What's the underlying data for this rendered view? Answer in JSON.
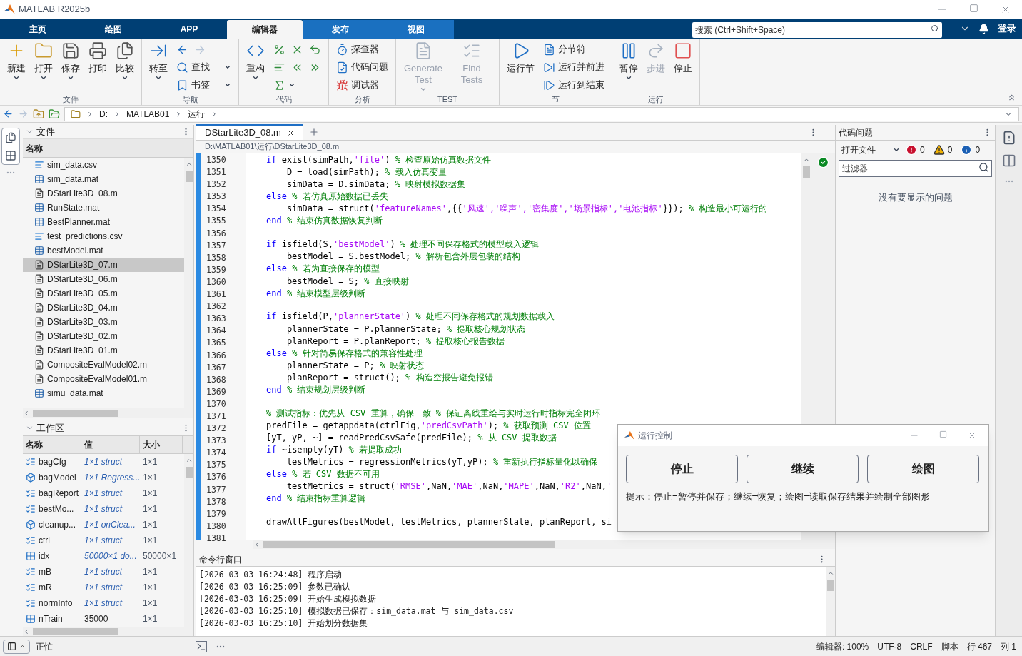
{
  "window": {
    "title": "MATLAB R2025b"
  },
  "tabs": [
    {
      "label": "主页",
      "selected": false,
      "kind": "standard"
    },
    {
      "label": "绘图",
      "selected": false,
      "kind": "standard"
    },
    {
      "label": "APP",
      "selected": false,
      "kind": "standard"
    },
    {
      "label": "编辑器",
      "selected": true,
      "kind": "contextual"
    },
    {
      "label": "发布",
      "selected": false,
      "kind": "contextual"
    },
    {
      "label": "视图",
      "selected": false,
      "kind": "contextual"
    }
  ],
  "search": {
    "placeholder": "搜索 (Ctrl+Shift+Space)"
  },
  "login": "登录",
  "toolstrip": [
    {
      "label": "文件",
      "items": [
        {
          "kind": "large",
          "label": "新建",
          "dropdown": true,
          "disabled": false
        },
        {
          "kind": "large",
          "label": "打开",
          "dropdown": true,
          "disabled": false
        },
        {
          "kind": "large",
          "label": "保存",
          "dropdown": true,
          "disabled": false
        },
        {
          "kind": "large",
          "label": "打印",
          "dropdown": false,
          "disabled": false
        },
        {
          "kind": "large",
          "label": "比较",
          "dropdown": true,
          "disabled": false
        }
      ]
    },
    {
      "label": "导航",
      "items": [
        {
          "kind": "large",
          "label": "转至",
          "dropdown": true,
          "disabled": false
        },
        {
          "kind": "stack",
          "rows": [
            [
              {
                "dropdown": false,
                "disabled": false
              },
              {
                "dropdown": false,
                "disabled": true
              }
            ],
            [
              {
                "label": "查找",
                "dropdown": true,
                "disabled": false
              }
            ],
            [
              {
                "label": "书签",
                "dropdown": true,
                "disabled": false
              }
            ]
          ]
        }
      ]
    },
    {
      "label": "代码",
      "items": [
        {
          "kind": "large",
          "label": "重构",
          "dropdown": true,
          "disabled": false
        },
        {
          "kind": "stack",
          "rows": [
            [
              {
                "dropdown": false,
                "disabled": false
              },
              {
                "dropdown": false,
                "disabled": false
              },
              {
                "dropdown": false,
                "disabled": false
              }
            ],
            [
              {
                "dropdown": false,
                "disabled": false
              },
              {
                "dropdown": false,
                "disabled": false
              },
              {
                "dropdown": false,
                "disabled": false
              }
            ],
            [
              {
                "dropdown": true,
                "disabled": false
              }
            ]
          ]
        }
      ]
    },
    {
      "label": "分析",
      "items": [
        {
          "kind": "stack",
          "rows": [
            [
              {
                "label": "探查器",
                "dropdown": false,
                "disabled": false
              }
            ],
            [
              {
                "label": "代码问题",
                "dropdown": false,
                "disabled": false
              }
            ],
            [
              {
                "label": "调试器",
                "dropdown": false,
                "disabled": false
              }
            ]
          ]
        }
      ]
    },
    {
      "label": "TEST",
      "items": [
        {
          "kind": "large",
          "label": "Generate Test",
          "dropdown": true,
          "disabled": true
        },
        {
          "kind": "large",
          "label": "Find Tests",
          "dropdown": false,
          "disabled": true
        }
      ]
    },
    {
      "label": "节",
      "items": [
        {
          "kind": "large",
          "label": "运行节",
          "dropdown": false,
          "disabled": false
        },
        {
          "kind": "stack",
          "rows": [
            [
              {
                "label": "分节符",
                "dropdown": false,
                "disabled": false
              }
            ],
            [
              {
                "label": "运行并前进",
                "dropdown": false,
                "disabled": false
              }
            ],
            [
              {
                "label": "运行到结束",
                "dropdown": false,
                "disabled": false
              }
            ]
          ]
        }
      ]
    },
    {
      "label": "运行",
      "items": [
        {
          "kind": "large",
          "label": "暂停",
          "dropdown": true,
          "disabled": false
        },
        {
          "kind": "large",
          "label": "步进",
          "dropdown": false,
          "disabled": true
        },
        {
          "kind": "large",
          "label": "停止",
          "dropdown": false,
          "disabled": false
        }
      ]
    }
  ],
  "address": {
    "back_disabled": false,
    "forward_disabled": true,
    "path": [
      "D:",
      "MATLAB01",
      "运行"
    ]
  },
  "files": {
    "title": "文件",
    "column": "名称",
    "items": [
      {
        "name": "sim_data.csv",
        "kind": "csv",
        "selected": false
      },
      {
        "name": "sim_data.mat",
        "kind": "mat",
        "selected": false
      },
      {
        "name": "DStarLite3D_08.m",
        "kind": "m",
        "selected": false
      },
      {
        "name": "RunState.mat",
        "kind": "mat",
        "selected": false
      },
      {
        "name": "BestPlanner.mat",
        "kind": "mat",
        "selected": false
      },
      {
        "name": "test_predictions.csv",
        "kind": "csv",
        "selected": false
      },
      {
        "name": "bestModel.mat",
        "kind": "mat",
        "selected": false
      },
      {
        "name": "DStarLite3D_07.m",
        "kind": "m",
        "selected": true
      },
      {
        "name": "DStarLite3D_06.m",
        "kind": "m",
        "selected": false
      },
      {
        "name": "DStarLite3D_05.m",
        "kind": "m",
        "selected": false
      },
      {
        "name": "DStarLite3D_04.m",
        "kind": "m",
        "selected": false
      },
      {
        "name": "DStarLite3D_03.m",
        "kind": "m",
        "selected": false
      },
      {
        "name": "DStarLite3D_02.m",
        "kind": "m",
        "selected": false
      },
      {
        "name": "DStarLite3D_01.m",
        "kind": "m",
        "selected": false
      },
      {
        "name": "CompositeEvalModel02.m",
        "kind": "m",
        "selected": false
      },
      {
        "name": "CompositeEvalModel01.m",
        "kind": "m",
        "selected": false
      },
      {
        "name": "simu_data.mat",
        "kind": "mat",
        "selected": false
      }
    ]
  },
  "workspace": {
    "title": "工作区",
    "columns": [
      "名称",
      "值",
      "大小"
    ],
    "rows": [
      {
        "name": "bagCfg",
        "value": "1×1 struct",
        "size": "1×1",
        "kind": "struct",
        "summary": true
      },
      {
        "name": "bagModel",
        "value": "1×1 Regress...",
        "size": "1×1",
        "kind": "object",
        "summary": true
      },
      {
        "name": "bagReport",
        "value": "1×1 struct",
        "size": "1×1",
        "kind": "struct",
        "summary": true
      },
      {
        "name": "bestMo...",
        "value": "1×1 struct",
        "size": "1×1",
        "kind": "struct",
        "summary": true
      },
      {
        "name": "cleanup...",
        "value": "1×1 onClea...",
        "size": "1×1",
        "kind": "object",
        "summary": true
      },
      {
        "name": "ctrl",
        "value": "1×1 struct",
        "size": "1×1",
        "kind": "struct",
        "summary": true
      },
      {
        "name": "idx",
        "value": "50000×1 do...",
        "size": "50000×1",
        "kind": "matrix",
        "summary": true
      },
      {
        "name": "mB",
        "value": "1×1 struct",
        "size": "1×1",
        "kind": "struct",
        "summary": true
      },
      {
        "name": "mR",
        "value": "1×1 struct",
        "size": "1×1",
        "kind": "struct",
        "summary": true
      },
      {
        "name": "normInfo",
        "value": "1×1 struct",
        "size": "1×1",
        "kind": "struct",
        "summary": true
      },
      {
        "name": "nTrain",
        "value": "35000",
        "size": "1×1",
        "kind": "matrix",
        "summary": false
      }
    ]
  },
  "editor": {
    "tabs": [
      {
        "label": "DStarLite3D_08.m",
        "selected": true
      }
    ],
    "path": "D:\\MATLAB01\\运行\\DStarLite3D_08.m",
    "lines": [
      {
        "number": "1350",
        "segments": [
          {
            "kind": "keyword",
            "text": "if"
          },
          {
            "kind": "plain",
            "text": " exist(simPath,"
          },
          {
            "kind": "string",
            "text": "'file'"
          },
          {
            "kind": "plain",
            "text": ") "
          },
          {
            "kind": "comment",
            "text": "% 检查原始仿真数据文件"
          }
        ]
      },
      {
        "number": "1351",
        "segments": [
          {
            "kind": "plain",
            "text": "    D = load(simPath); "
          },
          {
            "kind": "comment",
            "text": "% 载入仿真变量"
          }
        ]
      },
      {
        "number": "1352",
        "segments": [
          {
            "kind": "plain",
            "text": "    simData = D.simData; "
          },
          {
            "kind": "comment",
            "text": "% 映射模拟数据集"
          }
        ]
      },
      {
        "number": "1353",
        "segments": [
          {
            "kind": "keyword",
            "text": "else"
          },
          {
            "kind": "comment",
            "text": " % 若仿真原始数据已丢失"
          }
        ]
      },
      {
        "number": "1354",
        "segments": [
          {
            "kind": "plain",
            "text": "    simData = struct("
          },
          {
            "kind": "string",
            "text": "'featureNames'"
          },
          {
            "kind": "plain",
            "text": ",{{"
          },
          {
            "kind": "string",
            "text": "'风速','噪声','密集度','场景指标','电池指标'"
          },
          {
            "kind": "plain",
            "text": "}}); "
          },
          {
            "kind": "comment",
            "text": "% 构造最小可运行的"
          }
        ]
      },
      {
        "number": "1355",
        "segments": [
          {
            "kind": "keyword",
            "text": "end"
          },
          {
            "kind": "comment",
            "text": " % 结束仿真数据恢复判断"
          }
        ]
      },
      {
        "number": "1356"
      },
      {
        "number": "1357",
        "segments": [
          {
            "kind": "keyword",
            "text": "if"
          },
          {
            "kind": "plain",
            "text": " isfield(S,"
          },
          {
            "kind": "string",
            "text": "'bestModel'"
          },
          {
            "kind": "plain",
            "text": ") "
          },
          {
            "kind": "comment",
            "text": "% 处理不同保存格式的模型载入逻辑"
          }
        ]
      },
      {
        "number": "1358",
        "segments": [
          {
            "kind": "plain",
            "text": "    bestModel = S.bestModel; "
          },
          {
            "kind": "comment",
            "text": "% 解析包含外层包装的结构"
          }
        ]
      },
      {
        "number": "1359",
        "segments": [
          {
            "kind": "keyword",
            "text": "else"
          },
          {
            "kind": "comment",
            "text": " % 若为直接保存的模型"
          }
        ]
      },
      {
        "number": "1360",
        "segments": [
          {
            "kind": "plain",
            "text": "    bestModel = S; "
          },
          {
            "kind": "comment",
            "text": "% 直接映射"
          }
        ]
      },
      {
        "number": "1361",
        "segments": [
          {
            "kind": "keyword",
            "text": "end"
          },
          {
            "kind": "comment",
            "text": " % 结束模型层级判断"
          }
        ]
      },
      {
        "number": "1362"
      },
      {
        "number": "1363",
        "segments": [
          {
            "kind": "keyword",
            "text": "if"
          },
          {
            "kind": "plain",
            "text": " isfield(P,"
          },
          {
            "kind": "string",
            "text": "'plannerState'"
          },
          {
            "kind": "plain",
            "text": ") "
          },
          {
            "kind": "comment",
            "text": "% 处理不同保存格式的规划数据载入"
          }
        ]
      },
      {
        "number": "1364",
        "segments": [
          {
            "kind": "plain",
            "text": "    plannerState = P.plannerState; "
          },
          {
            "kind": "comment",
            "text": "% 提取核心规划状态"
          }
        ]
      },
      {
        "number": "1365",
        "segments": [
          {
            "kind": "plain",
            "text": "    planReport = P.planReport; "
          },
          {
            "kind": "comment",
            "text": "% 提取核心报告数据"
          }
        ]
      },
      {
        "number": "1366",
        "segments": [
          {
            "kind": "keyword",
            "text": "else"
          },
          {
            "kind": "comment",
            "text": " % 针对简易保存格式的兼容性处理"
          }
        ]
      },
      {
        "number": "1367",
        "segments": [
          {
            "kind": "plain",
            "text": "    plannerState = P; "
          },
          {
            "kind": "comment",
            "text": "% 映射状态"
          }
        ]
      },
      {
        "number": "1368",
        "segments": [
          {
            "kind": "plain",
            "text": "    planReport = struct(); "
          },
          {
            "kind": "comment",
            "text": "% 构造空报告避免报错"
          }
        ]
      },
      {
        "number": "1369",
        "segments": [
          {
            "kind": "keyword",
            "text": "end"
          },
          {
            "kind": "comment",
            "text": " % 结束规划层级判断"
          }
        ]
      },
      {
        "number": "1370"
      },
      {
        "number": "1371",
        "segments": [
          {
            "kind": "comment",
            "text": "% 测试指标：优先从 CSV 重算，确保一致 % 保证离线重绘与实时运行时指标完全闭环"
          }
        ]
      },
      {
        "number": "1372",
        "segments": [
          {
            "kind": "plain",
            "text": "predFile = getappdata(ctrlFig,"
          },
          {
            "kind": "string",
            "text": "'predCsvPath'"
          },
          {
            "kind": "plain",
            "text": "); "
          },
          {
            "kind": "comment",
            "text": "% 获取预测 CSV 位置"
          }
        ]
      },
      {
        "number": "1373",
        "segments": [
          {
            "kind": "plain",
            "text": "[yT, yP, ~] = readPredCsvSafe(predFile); "
          },
          {
            "kind": "comment",
            "text": "% 从 CSV 提取数据"
          }
        ]
      },
      {
        "number": "1374",
        "segments": [
          {
            "kind": "keyword",
            "text": "if"
          },
          {
            "kind": "plain",
            "text": " ~isempty(yT) "
          },
          {
            "kind": "comment",
            "text": "% 若提取成功"
          }
        ]
      },
      {
        "number": "1375",
        "segments": [
          {
            "kind": "plain",
            "text": "    testMetrics = regressionMetrics(yT,yP); "
          },
          {
            "kind": "comment",
            "text": "% 重新执行指标量化以确保"
          }
        ]
      },
      {
        "number": "1376",
        "segments": [
          {
            "kind": "keyword",
            "text": "else"
          },
          {
            "kind": "comment",
            "text": " % 若 CSV 数据不可用"
          }
        ]
      },
      {
        "number": "1377",
        "segments": [
          {
            "kind": "plain",
            "text": "    testMetrics = struct("
          },
          {
            "kind": "string",
            "text": "'RMSE'"
          },
          {
            "kind": "plain",
            "text": ",NaN,"
          },
          {
            "kind": "string",
            "text": "'MAE'"
          },
          {
            "kind": "plain",
            "text": ",NaN,"
          },
          {
            "kind": "string",
            "text": "'MAPE'"
          },
          {
            "kind": "plain",
            "text": ",NaN,"
          },
          {
            "kind": "string",
            "text": "'R2'"
          },
          {
            "kind": "plain",
            "text": ",NaN,"
          },
          {
            "kind": "string",
            "text": "'"
          }
        ]
      },
      {
        "number": "1378",
        "segments": [
          {
            "kind": "keyword",
            "text": "end"
          },
          {
            "kind": "comment",
            "text": " % 结束指标重算逻辑"
          }
        ]
      },
      {
        "number": "1379"
      },
      {
        "number": "1380",
        "segments": [
          {
            "kind": "plain",
            "text": "drawAllFigures(bestModel, testMetrics, plannerState, planReport, si"
          }
        ]
      },
      {
        "number": "1381"
      }
    ]
  },
  "problems": {
    "title": "代码问题",
    "scope": "打开文件",
    "errors": "0",
    "warnings": "0",
    "infos": "0",
    "filter_placeholder": "过滤器",
    "empty_message": "没有要显示的问题"
  },
  "command_window": {
    "title": "命令行窗口",
    "lines": [
      "[2026-03-03 16:24:48] 程序启动",
      "[2026-03-03 16:25:09] 参数已确认",
      "[2026-03-03 16:25:09] 开始生成模拟数据",
      "[2026-03-03 16:25:10] 模拟数据已保存：sim_data.mat 与 sim_data.csv",
      "[2026-03-03 16:25:10] 开始划分数据集"
    ]
  },
  "dialog": {
    "title": "运行控制",
    "buttons": [
      "停止",
      "继续",
      "绘图"
    ],
    "hint": "提示：停止=暂停并保存；继续=恢复；绘图=读取保存结果并绘制全部图形"
  },
  "status_bar": {
    "state": "正忙",
    "items": [
      "编辑器: 100%",
      "UTF-8",
      "CRLF",
      "脚本",
      "行 467",
      "列 1"
    ]
  }
}
